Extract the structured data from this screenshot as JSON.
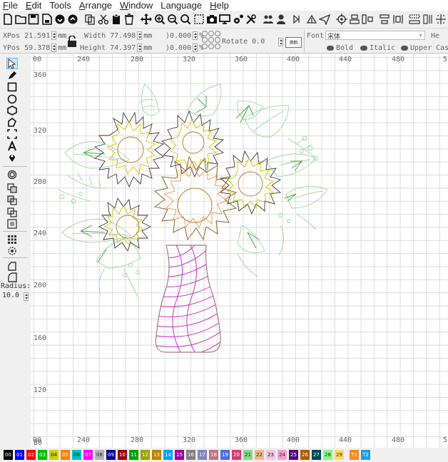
{
  "menu": [
    {
      "label": "File",
      "accel": "F",
      "rest": "ile"
    },
    {
      "label": "Edit",
      "accel": "E",
      "rest": "dit"
    },
    {
      "label": "Tools",
      "accel": "",
      "rest": "Tools"
    },
    {
      "label": "Arrange",
      "accel": "A",
      "rest": "rrange"
    },
    {
      "label": "Window",
      "accel": "W",
      "rest": "indow"
    },
    {
      "label": "Language",
      "accel": "",
      "rest": "Language"
    },
    {
      "label": "Help",
      "accel": "H",
      "rest": "elp"
    }
  ],
  "options": {
    "xpos_label": "XPos",
    "xpos_value": "21.591",
    "ypos_label": "YPos",
    "ypos_value": "59.378",
    "width_label": "Width",
    "width_value": "77.498",
    "height_label": "Height",
    "height_value": "74.397",
    "unit": "mm",
    "scale_x": ")0.000",
    "scale_y": ")0.000",
    "percent": "%",
    "rotate_label": "Rotate",
    "rotate_value": "0.0",
    "mm_button": "mm",
    "font_label": "Font",
    "font_value": "宋体",
    "bold_label": "Bold",
    "italic_label": "Italic",
    "upper_label": "Upper Cas",
    "he_label": "He"
  },
  "left_panel": {
    "radius_label": "Radius:",
    "radius_value": "10.0"
  },
  "ruler_top": [
    "00",
    "240",
    "280",
    "320",
    "360",
    "400",
    "440",
    "480",
    "5"
  ],
  "ruler_bottom": [
    "00",
    "240",
    "280",
    "320",
    "360",
    "400",
    "440",
    "480",
    "5"
  ],
  "ruler_left": [
    "360",
    "320",
    "280",
    "240",
    "200",
    "160",
    "120",
    "80"
  ],
  "palette": [
    {
      "label": "00",
      "color": "#000000"
    },
    {
      "label": "01",
      "color": "#0000ff"
    },
    {
      "label": "02",
      "color": "#ff0000"
    },
    {
      "label": "03",
      "color": "#00c000"
    },
    {
      "label": "04",
      "color": "#d0d000"
    },
    {
      "label": "05",
      "color": "#ff8000"
    },
    {
      "label": "06",
      "color": "#00c0c0"
    },
    {
      "label": "07",
      "color": "#ff00ff"
    },
    {
      "label": "08",
      "color": "#b4b4b4"
    },
    {
      "label": "09",
      "color": "#0000a0"
    },
    {
      "label": "10",
      "color": "#a00000"
    },
    {
      "label": "11",
      "color": "#00a000"
    },
    {
      "label": "12",
      "color": "#a0a000"
    },
    {
      "label": "13",
      "color": "#c08000"
    },
    {
      "label": "14",
      "color": "#00a0ff"
    },
    {
      "label": "15",
      "color": "#a000a0"
    },
    {
      "label": "16",
      "color": "#808080"
    },
    {
      "label": "17",
      "color": "#7d87b9"
    },
    {
      "label": "18",
      "color": "#bb7784"
    },
    {
      "label": "19",
      "color": "#4a6fe3"
    },
    {
      "label": "20",
      "color": "#d33f6a"
    },
    {
      "label": "21",
      "color": "#8cd78c"
    },
    {
      "label": "22",
      "color": "#f0b98d"
    },
    {
      "label": "23",
      "color": "#f6c4e1"
    },
    {
      "label": "24",
      "color": "#fa9ed4"
    },
    {
      "label": "25",
      "color": "#500a78"
    },
    {
      "label": "26",
      "color": "#b45a00"
    },
    {
      "label": "27",
      "color": "#004754"
    },
    {
      "label": "28",
      "color": "#86fa88"
    },
    {
      "label": "29",
      "color": "#ffdb66"
    },
    {
      "label": "T1",
      "color": "#f38b1f"
    },
    {
      "label": "T2",
      "color": "#1f9bdf"
    }
  ]
}
